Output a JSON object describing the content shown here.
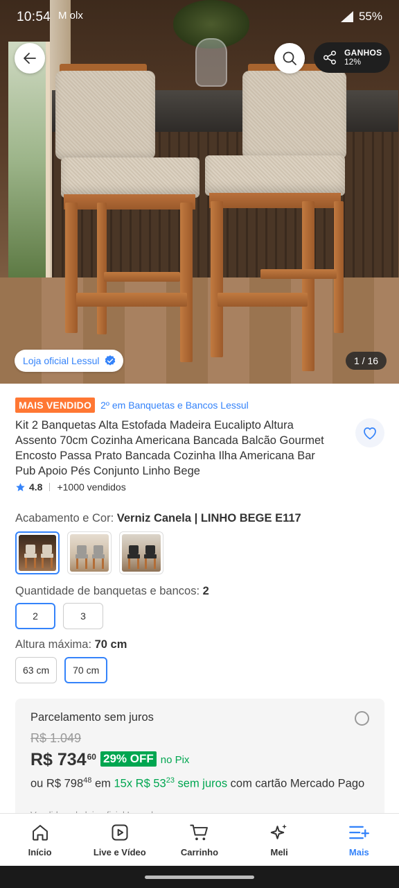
{
  "status_bar": {
    "time": "10:54",
    "apps": "M  olx",
    "battery": "55%"
  },
  "gallery": {
    "share_label_top": "GANHOS",
    "share_label_bottom": "12%",
    "store_badge": "Loja oficial Lessul",
    "counter": "1 / 16"
  },
  "product": {
    "best_seller_tag": "MAIS VENDIDO",
    "rank_text": "2º em Banquetas e Bancos Lessul",
    "title": "Kit 2 Banquetas Alta Estofada Madeira Eucalipto Altura Assento 70cm Cozinha Americana Bancada Balcão Gourmet Encosto Passa Prato Bancada Cozinha Ilha Americana Bar Pub Apoio Pés Conjunto Linho Bege",
    "rating": "4.8",
    "sold": "+1000 vendidos"
  },
  "variations": {
    "finish_label": "Acabamento e Cor: ",
    "finish_value": "Verniz Canela | LINHO BEGE E117",
    "quantity_label": "Quantidade de banquetas e bancos: ",
    "quantity_value": "2",
    "quantity_options": [
      "2",
      "3"
    ],
    "height_label": "Altura máxima: ",
    "height_value": "70 cm",
    "height_options": [
      "63 cm",
      "70 cm"
    ]
  },
  "price": {
    "card_title": "Parcelamento sem juros",
    "old_price": "R$ 1.049",
    "price": "R$ 734",
    "price_cents": "60",
    "off": "29% OFF",
    "pix": "no Pix",
    "install_prefix": "ou R$ 798",
    "install_prefix_cents": "48",
    "install_mid": " em ",
    "install_green": "15x R$ 53",
    "install_green_cents": "23",
    "install_green_suffix": " sem juros",
    "install_suffix": " com cartão Mercado Pago",
    "cut_text": "Vendido pela loja oficial Lessul"
  },
  "bottom_nav": {
    "items": [
      {
        "label": "Início",
        "icon": "home-icon"
      },
      {
        "label": "Live e Vídeo",
        "icon": "play-icon"
      },
      {
        "label": "Carrinho",
        "icon": "cart-icon"
      },
      {
        "label": "Meli",
        "icon": "sparkle-icon"
      },
      {
        "label": "Mais",
        "icon": "menu-icon"
      }
    ]
  },
  "colors": {
    "accent": "#3483fa",
    "green": "#00a650",
    "orange_tag": "#ff7733"
  }
}
